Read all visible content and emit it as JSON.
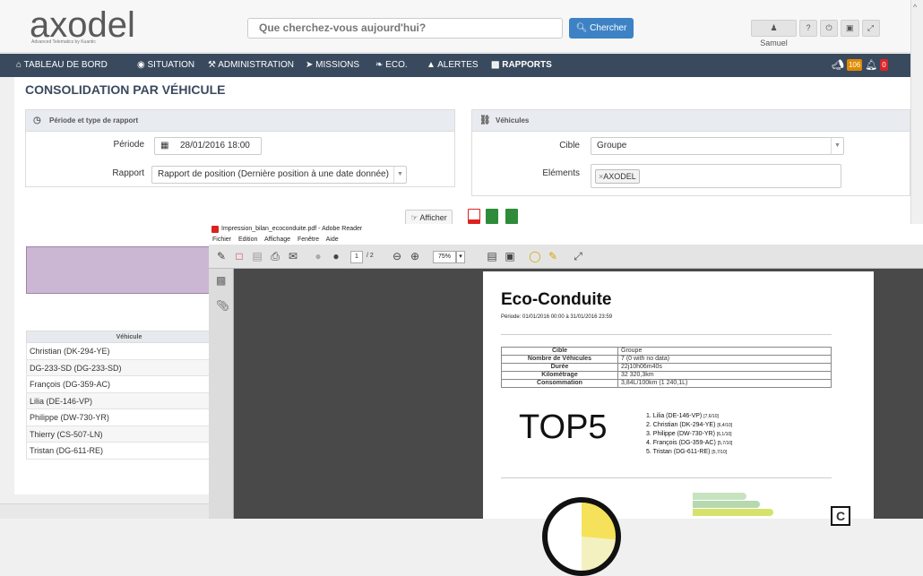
{
  "header": {
    "logo_text": "axodel",
    "logo_subtitle": "Advanced Telematics by Kuantic",
    "search_placeholder": "Que cherchez-vous aujourd'hui?",
    "search_button": "Chercher",
    "user_name": "Samuel"
  },
  "nav": {
    "items": [
      {
        "label": "TABLEAU DE BORD",
        "icon": "home-icon"
      },
      {
        "label": "SITUATION",
        "icon": "globe-icon"
      },
      {
        "label": "ADMINISTRATION",
        "icon": "wrench-icon"
      },
      {
        "label": "MISSIONS",
        "icon": "send-icon"
      },
      {
        "label": "ECO.",
        "icon": "leaf-icon"
      },
      {
        "label": "ALERTES",
        "icon": "warning-icon"
      },
      {
        "label": "RAPPORTS",
        "icon": "folder-icon"
      }
    ],
    "badge_messages": "106",
    "badge_alerts": "0"
  },
  "page": {
    "title": "CONSOLIDATION PAR VÉHICULE",
    "period_panel_title": "Période et type de rapport",
    "periode_label": "Période",
    "periode_value": "28/01/2016 18:00",
    "rapport_label": "Rapport",
    "rapport_value": "Rapport de position (Dernière position à une date donnée)",
    "vehicles_panel_title": "Véhicules",
    "cible_label": "Cible",
    "cible_value": "Groupe",
    "elements_label": "Eléments",
    "elements_tag": "AXODEL",
    "afficher_button": "Afficher"
  },
  "vehicle_table": {
    "header": "Véhicule",
    "rows": [
      "Christian (DK-294-YE)",
      "DG-233-SD (DG-233-SD)",
      "François (DG-359-AC)",
      "Lilia (DE-146-VP)",
      "Philippe (DW-730-YR)",
      "Thierry (CS-507-LN)",
      "Tristan (DG-611-RE)"
    ]
  },
  "reader": {
    "window_title": "Impression_bilan_ecoconduite.pdf - Adobe Reader",
    "menu": [
      "Fichier",
      "Edition",
      "Affichage",
      "Fenêtre",
      "Aide"
    ],
    "page_current": "1",
    "page_total": "/ 2",
    "zoom": "75%"
  },
  "pdf": {
    "title": "Eco-Conduite",
    "periode": "Période: 01/01/2016 00:00 à 31/01/2016 23:59",
    "table": [
      {
        "k": "Cible",
        "v": "Groupe"
      },
      {
        "k": "Nombre de Véhicules",
        "v": "7 (0 with no data)"
      },
      {
        "k": "Durée",
        "v": "22j10h06m40s"
      },
      {
        "k": "Kilométrage",
        "v": "32 320,3km"
      },
      {
        "k": "Consommation",
        "v": "3,84L/100km (1 240,1L)"
      }
    ],
    "top5_label": "TOP5",
    "top5": [
      {
        "name": "1. Lilia (DE-146-VP)",
        "score": "[7,6/10]"
      },
      {
        "name": "2. Christian (DK-294-YE)",
        "score": "[6,4/10]"
      },
      {
        "name": "3. Philippe (DW-730-YR)",
        "score": "[6,1/10]"
      },
      {
        "name": "4. François (DG-359-AC)",
        "score": "[5,7/10]"
      },
      {
        "name": "5. Tristan (DG-611-RE)",
        "score": "[5,7/10]"
      }
    ],
    "class_letter": "C"
  },
  "colors": {
    "nav_bg": "#3a4a5e",
    "accent_blue": "#3d82c4",
    "lilac": "#cbb6d3",
    "badge_orange": "#e08a00",
    "badge_red": "#d9262a"
  }
}
